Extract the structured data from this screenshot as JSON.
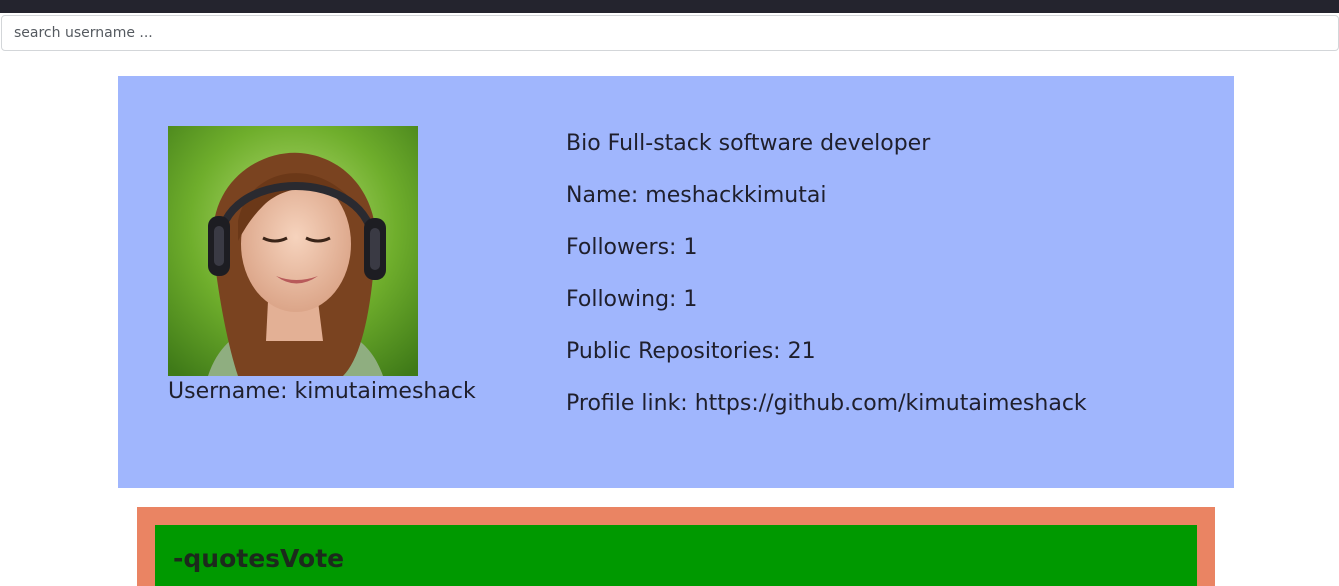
{
  "search": {
    "placeholder": "search username ..."
  },
  "profile": {
    "avatar_alt": "profile avatar",
    "username_label": "Username: kimutaimeshack",
    "bio": "Bio Full-stack software developer",
    "name": "Name: meshackkimutai",
    "followers": "Followers: 1",
    "following": "Following: 1",
    "public_repos": "Public Repositories: 21",
    "profile_link": "Profile link: https://github.com/kimutaimeshack"
  },
  "quotes": {
    "title": "-quotesVote"
  },
  "colors": {
    "topbar": "#24242e",
    "profile_card": "#a0b6fd",
    "quotes_outer": "#ea8463",
    "quotes_inner": "#009900"
  }
}
